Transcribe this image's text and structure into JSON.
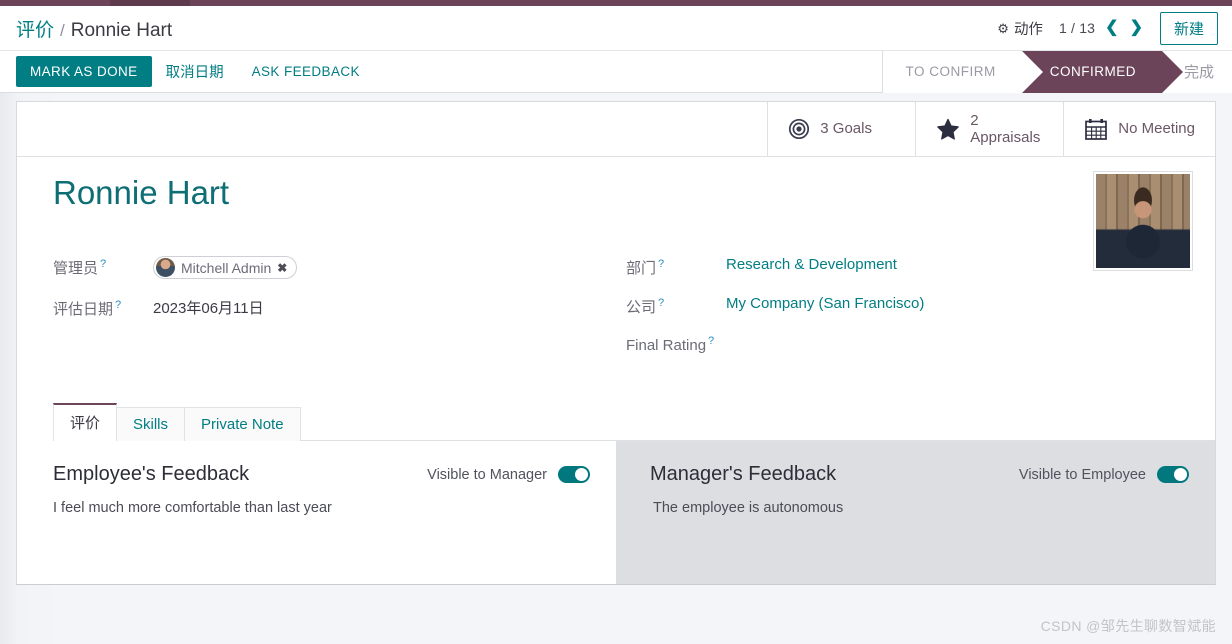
{
  "breadcrumb": {
    "root": "评价",
    "separator": "/",
    "current": "Ronnie Hart"
  },
  "control_panel": {
    "action_label": "动作",
    "action_icon": "gear-icon",
    "pager_count": "1 / 13",
    "prev_glyph": "❮",
    "next_glyph": "❯",
    "new_label": "新建"
  },
  "action_bar": {
    "mark_as_done": "MARK AS DONE",
    "cancel_date": "取消日期",
    "ask_feedback": "ASK FEEDBACK"
  },
  "statusbar": {
    "stages": [
      {
        "label": "TO CONFIRM",
        "active": false
      },
      {
        "label": "CONFIRMED",
        "active": true
      },
      {
        "label": "完成",
        "active": false
      }
    ]
  },
  "smart_buttons": [
    {
      "icon": "target-icon",
      "line1": "3 Goals",
      "line2": ""
    },
    {
      "icon": "star-icon",
      "line1": "2",
      "line2": "Appraisals"
    },
    {
      "icon": "calendar-icon",
      "line1": "No Meeting",
      "line2": ""
    }
  ],
  "record": {
    "title": "Ronnie Hart",
    "avatar_alt": "employee-photo"
  },
  "fields_left": [
    {
      "label": "管理员",
      "help": "?",
      "type": "tag",
      "value": "Mitchell Admin",
      "remove_glyph": "✖"
    },
    {
      "label": "评估日期",
      "help": "?",
      "type": "text",
      "value": "2023年06月11日"
    }
  ],
  "fields_right": [
    {
      "label": "部门",
      "help": "?",
      "type": "link",
      "value": "Research & Development"
    },
    {
      "label": "公司",
      "help": "?",
      "type": "link",
      "value": "My Company (San Francisco)"
    },
    {
      "label": "Final Rating",
      "help": "?",
      "type": "text",
      "value": ""
    }
  ],
  "notebook": {
    "tabs": [
      {
        "label": "评价",
        "active": true
      },
      {
        "label": "Skills",
        "active": false
      },
      {
        "label": "Private Note",
        "active": false
      }
    ]
  },
  "feedback": {
    "employee": {
      "title": "Employee's Feedback",
      "toggle_label": "Visible to Manager",
      "toggle_on": true,
      "body": "I feel much more comfortable than last year"
    },
    "manager": {
      "title": "Manager's Feedback",
      "toggle_label": "Visible to Employee",
      "toggle_on": true,
      "body": "The employee is autonomous"
    }
  },
  "watermark": "CSDN @邹先生聊数智斌能",
  "colors": {
    "primary_teal": "#017e84",
    "brand_purple": "#6b4459",
    "panel_gray": "#dcdee2",
    "page_bg": "#f4f5f8"
  }
}
